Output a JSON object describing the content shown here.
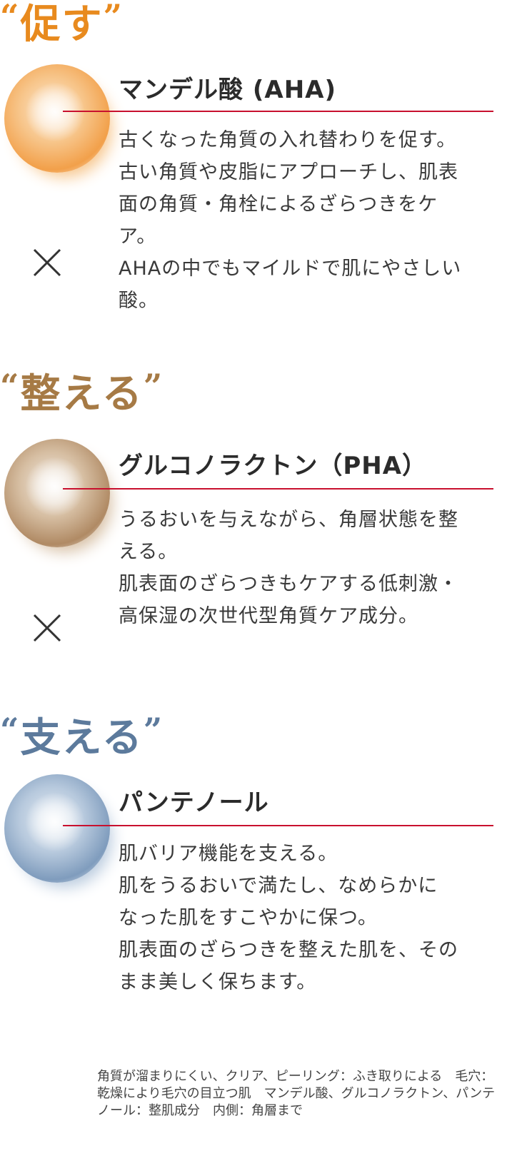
{
  "sections": [
    {
      "heading": "促す",
      "heading_color": "#e88a1e",
      "orb_colors": [
        "#f2a04a",
        "#f7c58a",
        "#fde9d2"
      ],
      "title": "マンデル酸 (AHA)",
      "desc_lines": [
        "古くなった角質の入れ替わりを促す。",
        "古い角質や皮脂にアプローチし、肌表",
        "面の角質・角栓によるざらつきをケ",
        "ア。",
        "AHAの中でもマイルドで肌にやさしい",
        "酸。"
      ]
    },
    {
      "heading": "整える",
      "heading_color": "#a67a45",
      "orb_colors": [
        "#b08a64",
        "#d6bea2",
        "#f3ebe2"
      ],
      "title": "グルコノラクトン（PHA）",
      "desc_lines": [
        "うるおいを与えながら、角層状態を整",
        "える。",
        "肌表面のざらつきもケアする低刺激・",
        "高保湿の次世代型角質ケア成分。"
      ]
    },
    {
      "heading": "支える",
      "heading_color": "#5c7a9c",
      "orb_colors": [
        "#7f9cbd",
        "#b7c9dd",
        "#e6edf4"
      ],
      "title": "パンテノール",
      "desc_lines": [
        "肌バリア機能を支える。",
        "肌をうるおいで満たし、なめらかに",
        "なった肌をすこやかに保つ。",
        "肌表面のざらつきを整えた肌を、その",
        "まま美しく保ちます。"
      ]
    }
  ],
  "quote_open": "“",
  "quote_close": "”",
  "connector_icon": "times-icon",
  "accent_rule_color": "#c8102e",
  "footnote": "角質が溜まりにくい、クリア、ピーリング：ふき取りによる　毛穴：乾燥により毛穴の目立つ肌　マンデル酸、グルコノラクトン、パンテノール：整肌成分　内側：角層まで"
}
